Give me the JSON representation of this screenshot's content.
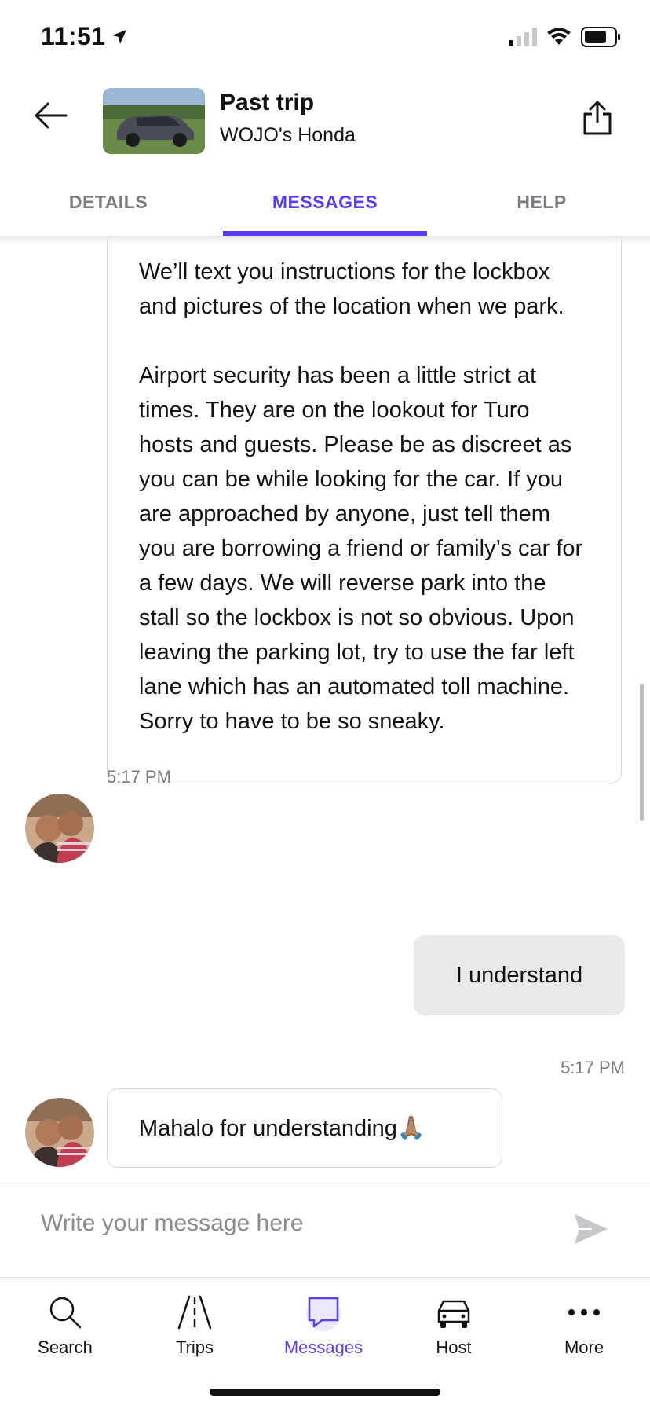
{
  "status_bar": {
    "time": "11:51"
  },
  "header": {
    "title": "Past trip",
    "subtitle": "WOJO's Honda"
  },
  "tabs": [
    {
      "label": "DETAILS",
      "active": false
    },
    {
      "label": "MESSAGES",
      "active": true
    },
    {
      "label": "HELP",
      "active": false
    }
  ],
  "messages": [
    {
      "from": "host",
      "paragraphs": [
        "We’ll text you instructions for the lockbox and pictures of the location when we park.",
        "Airport security has been a little strict at times. They are on the lookout for Turo hosts and guests. Please be as discreet as you can be while looking for the car. If you are approached by anyone, just tell them you are borrowing a friend or family’s car for a few days. We will reverse park into the stall so the lockbox is not so obvious. Upon leaving the parking lot, try to use the far left lane which has an automated toll machine. Sorry to have to be so sneaky."
      ],
      "time": "5:17 PM"
    },
    {
      "from": "me",
      "text": "I understand",
      "time": "5:17 PM"
    },
    {
      "from": "host",
      "text": "Mahalo for understanding🙏🏽"
    }
  ],
  "composer": {
    "placeholder": "Write your message here"
  },
  "nav": [
    {
      "label": "Search",
      "icon": "search-icon"
    },
    {
      "label": "Trips",
      "icon": "road-icon"
    },
    {
      "label": "Messages",
      "icon": "chat-bubble-icon",
      "active": true
    },
    {
      "label": "Host",
      "icon": "car-icon"
    },
    {
      "label": "More",
      "icon": "more-dots-icon"
    }
  ],
  "colors": {
    "accent": "#593cfb",
    "outgoing_bubble": "#e9e9ea",
    "muted_text": "#7a7a80"
  }
}
